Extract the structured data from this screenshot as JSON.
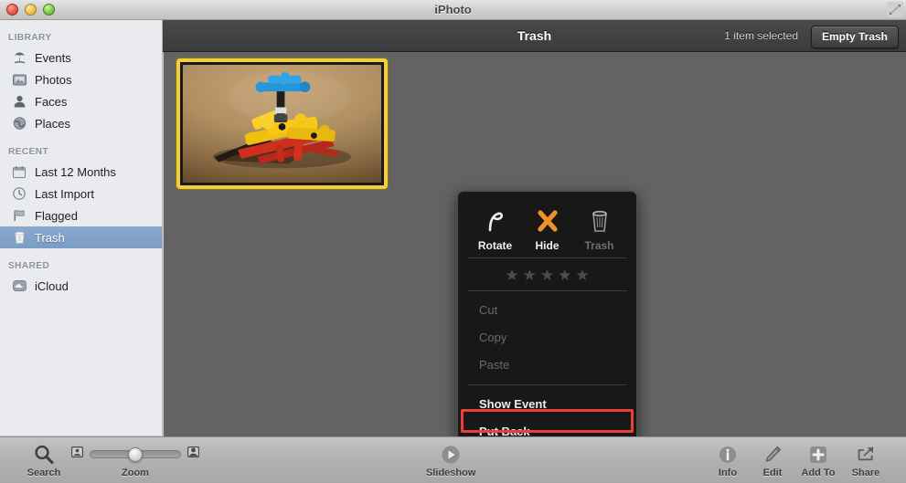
{
  "window": {
    "title": "iPhoto",
    "controls": [
      "close",
      "minimize",
      "zoom"
    ]
  },
  "sidebar": {
    "sections": [
      {
        "header": "LIBRARY",
        "items": [
          {
            "label": "Events",
            "icon": "events-icon",
            "selected": false
          },
          {
            "label": "Photos",
            "icon": "photos-icon",
            "selected": false
          },
          {
            "label": "Faces",
            "icon": "faces-icon",
            "selected": false
          },
          {
            "label": "Places",
            "icon": "places-icon",
            "selected": false
          }
        ]
      },
      {
        "header": "RECENT",
        "items": [
          {
            "label": "Last 12 Months",
            "icon": "calendar-icon",
            "selected": false
          },
          {
            "label": "Last Import",
            "icon": "clock-icon",
            "selected": false
          },
          {
            "label": "Flagged",
            "icon": "flag-icon",
            "selected": false
          },
          {
            "label": "Trash",
            "icon": "trash-icon",
            "selected": true
          }
        ]
      },
      {
        "header": "SHARED",
        "items": [
          {
            "label": "iCloud",
            "icon": "icloud-icon",
            "selected": false
          }
        ]
      }
    ]
  },
  "topbar": {
    "title": "Trash",
    "selection_status": "1 item selected",
    "empty_trash_label": "Empty Trash"
  },
  "content": {
    "thumbnail": {
      "name": "photo-thumbnail",
      "selected": true,
      "selection_color": "#f2cf3f",
      "subject": "lego-technic-model"
    },
    "background_color": "#636363"
  },
  "context_menu": {
    "actions": [
      {
        "label": "Rotate",
        "icon": "rotate-icon",
        "disabled": false
      },
      {
        "label": "Hide",
        "icon": "hide-x-icon",
        "disabled": false
      },
      {
        "label": "Trash",
        "icon": "trash-can-icon",
        "disabled": true
      }
    ],
    "rating": {
      "stars_total": 5,
      "stars_filled": 0
    },
    "items": [
      {
        "label": "Cut",
        "disabled": true,
        "bold": false,
        "highlighted": false
      },
      {
        "label": "Copy",
        "disabled": true,
        "bold": false,
        "highlighted": false
      },
      {
        "label": "Paste",
        "disabled": true,
        "bold": false,
        "highlighted": false
      },
      {
        "label": "Show Event",
        "disabled": false,
        "bold": true,
        "highlighted": false
      },
      {
        "label": "Put Back",
        "disabled": false,
        "bold": true,
        "highlighted": true
      }
    ],
    "highlight_color": "#e8413a"
  },
  "bottombar": {
    "search": {
      "label": "Search",
      "icon": "search-icon"
    },
    "zoom": {
      "label": "Zoom",
      "value_percent": 50,
      "min_icon": "small-photo-icon",
      "max_icon": "large-photo-icon"
    },
    "slideshow": {
      "label": "Slideshow",
      "icon": "play-icon"
    },
    "right_items": [
      {
        "label": "Info",
        "icon": "info-icon"
      },
      {
        "label": "Edit",
        "icon": "pencil-icon"
      },
      {
        "label": "Add To",
        "icon": "plus-box-icon"
      },
      {
        "label": "Share",
        "icon": "share-icon"
      }
    ]
  }
}
